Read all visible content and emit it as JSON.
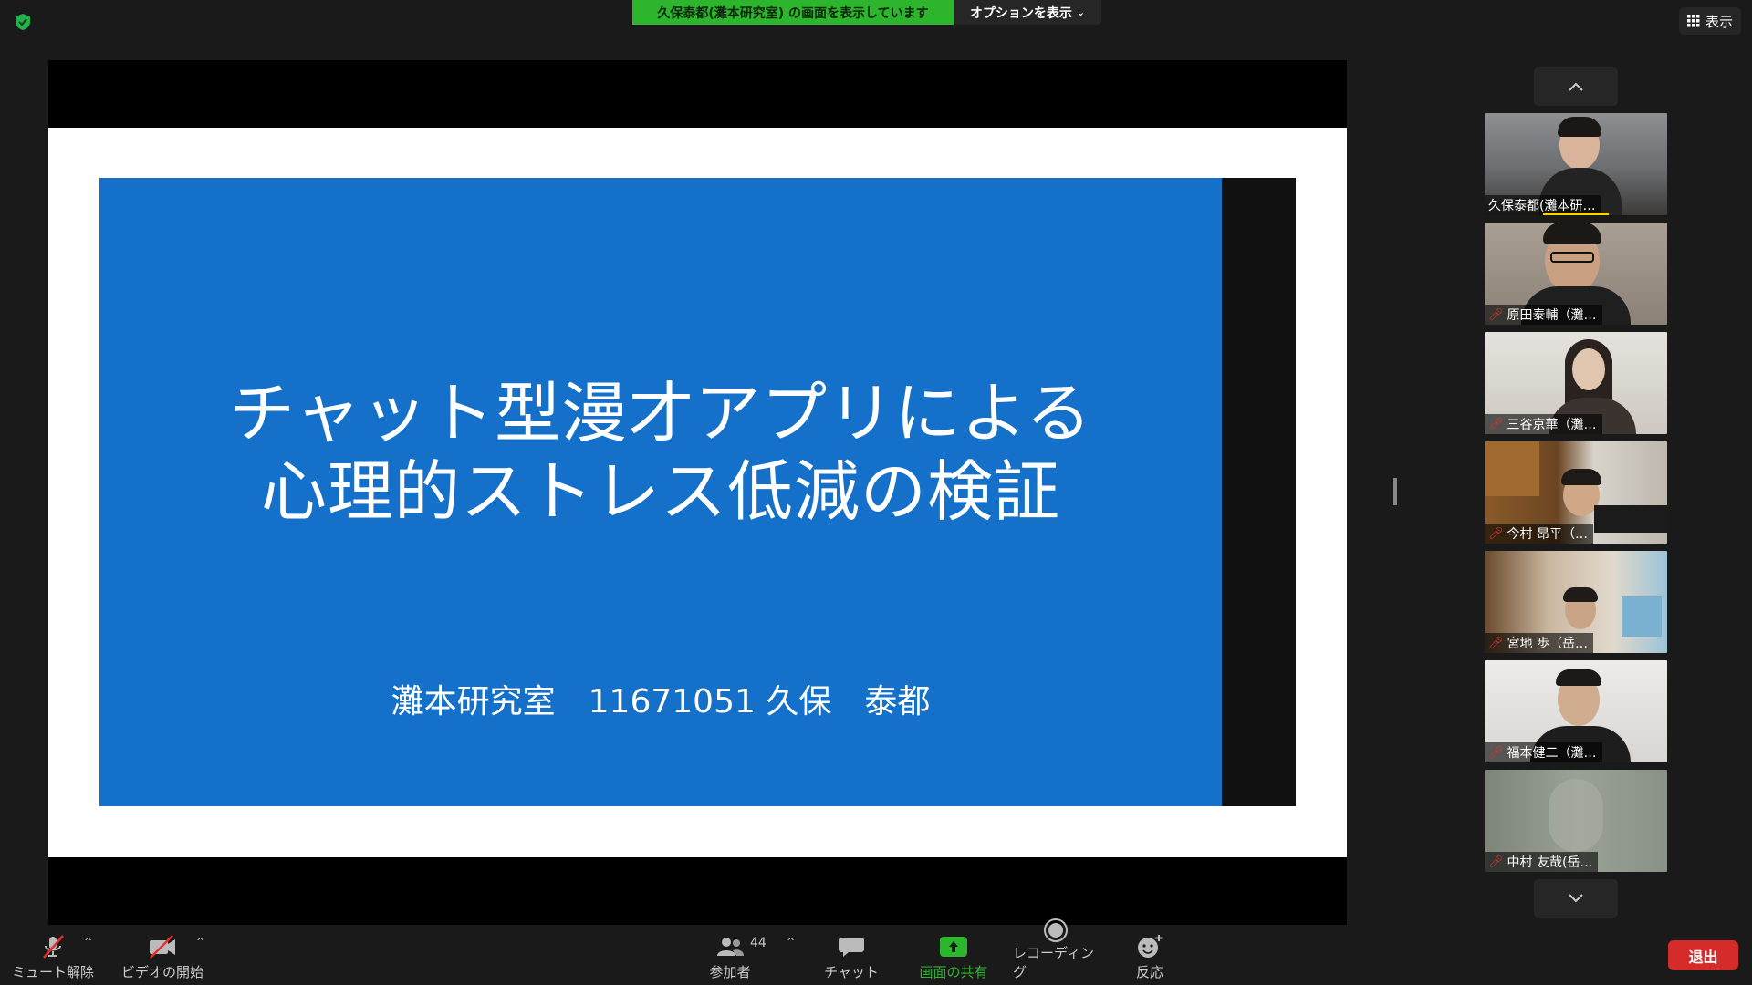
{
  "banner": {
    "sharing_text": "久保泰都(灘本研究室) の画面を表示しています",
    "options_label": "オプションを表示",
    "view_label": "表示"
  },
  "slide": {
    "title_line1": "チャット型漫才アプリによる",
    "title_line2": "心理的ストレス低減の検証",
    "author_line": "灘本研究室　11671051  久保　泰都"
  },
  "participants": [
    {
      "name": "久保泰都(灘本研…",
      "muted": false,
      "speaking": true
    },
    {
      "name": "原田泰輔（灘…",
      "muted": true
    },
    {
      "name": "三谷京華（灘…",
      "muted": true
    },
    {
      "name": "今村 昂平（…",
      "muted": true
    },
    {
      "name": "宮地 歩（岳…",
      "muted": true
    },
    {
      "name": "福本健二（灘…",
      "muted": true
    },
    {
      "name": "中村 友哉(岳…",
      "muted": true
    }
  ],
  "toolbar": {
    "mute_label": "ミュート解除",
    "video_label": "ビデオの開始",
    "participants_label": "参加者",
    "participants_count": "44",
    "chat_label": "チャット",
    "share_label": "画面の共有",
    "record_label": "レコーディング",
    "reactions_label": "反応",
    "leave_label": "退出"
  },
  "colors": {
    "share_green": "#2db52d",
    "slide_blue": "#1470c8",
    "leave_red": "#d62b2b"
  }
}
